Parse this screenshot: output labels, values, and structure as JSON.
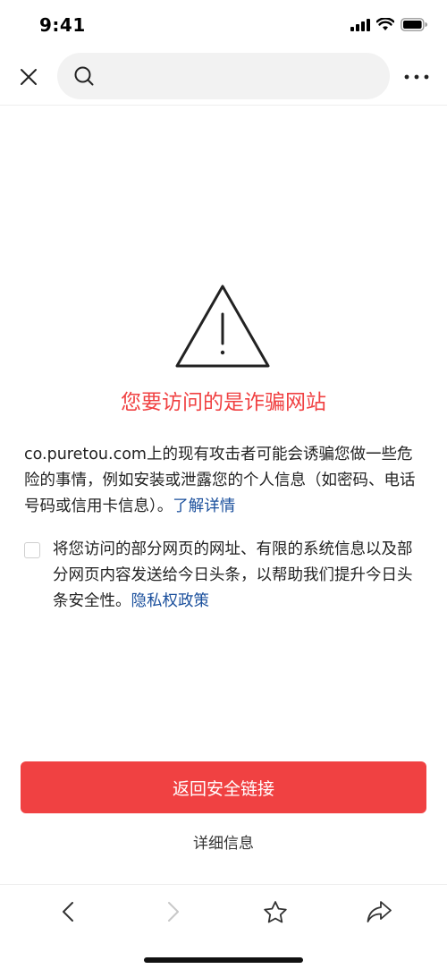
{
  "status_bar": {
    "time": "9:41"
  },
  "nav": {
    "search_placeholder": ""
  },
  "warning": {
    "title": "您要访问的是诈骗网站",
    "description": "co.puretou.com上的现有攻击者可能会诱骗您做一些危险的事情，例如安装或泄露您的个人信息（如密码、电话号码或信用卡信息）。",
    "learn_more": "了解详情"
  },
  "consent": {
    "text": "将您访问的部分网页的网址、有限的系统信息以及部分网页内容发送给今日头条，以帮助我们提升今日头条安全性。",
    "privacy_link": "隐私权政策",
    "checked": false
  },
  "actions": {
    "primary": "返回安全链接",
    "details": "详细信息"
  },
  "colors": {
    "accent": "#f04142",
    "link": "#1a4f9c"
  },
  "icons": {
    "close": "close-icon",
    "search": "search-icon",
    "more": "more-icon",
    "warning": "warning-triangle-icon",
    "back": "chevron-left-icon",
    "forward": "chevron-right-icon",
    "favorite": "star-icon",
    "share": "share-icon"
  }
}
